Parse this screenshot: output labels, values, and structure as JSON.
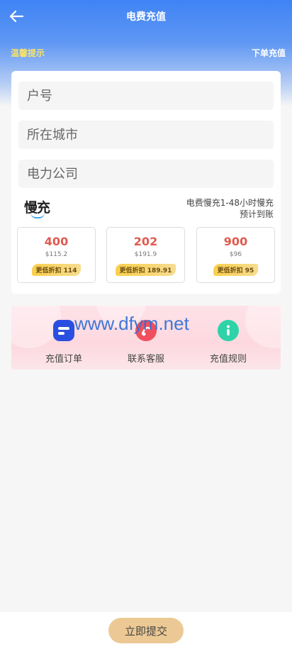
{
  "header": {
    "title": "电费充值",
    "notice_label": "温馨提示",
    "notice_text": "下单充值"
  },
  "form": {
    "account_placeholder": "户号",
    "city_placeholder": "所在城市",
    "company_placeholder": "电力公司"
  },
  "mode": {
    "logo_text": "慢充",
    "desc_line1": "电费慢充1-48小时慢充",
    "desc_line2": "预计到账"
  },
  "amounts": [
    {
      "value": "400",
      "price": "$115.2",
      "badge": "更低折扣 114"
    },
    {
      "value": "202",
      "price": "$191.9",
      "badge": "更低折扣 189.91"
    },
    {
      "value": "900",
      "price": "$96",
      "badge": "更低折扣 95"
    }
  ],
  "services": [
    {
      "label": "充值订单",
      "color": "#2a4fe0"
    },
    {
      "label": "联系客服",
      "color": "#f0505e"
    },
    {
      "label": "充值规则",
      "color": "#2ed3a8"
    }
  ],
  "watermark": "www.dfym.net",
  "footer": {
    "submit_label": "立即提交"
  },
  "colors": {
    "accent_blue": "#3f83f5",
    "price_red": "#e05a4e",
    "submit_bg": "#ecc994"
  }
}
